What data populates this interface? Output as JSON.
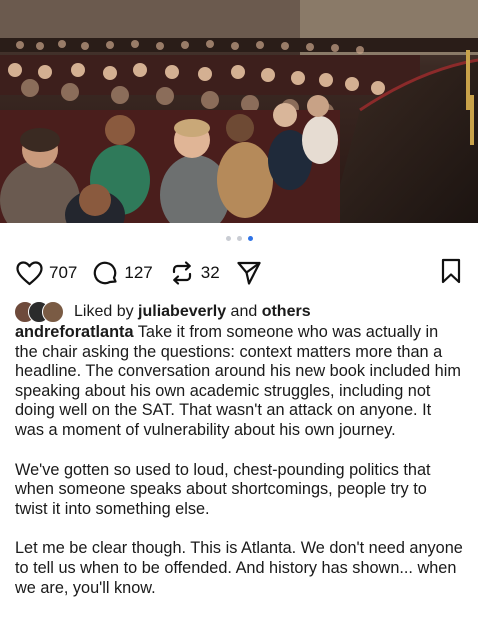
{
  "post": {
    "carousel": {
      "total": 3,
      "active_index": 2
    },
    "actions": {
      "like_count": "707",
      "comment_count": "127",
      "repost_count": "32",
      "icons": [
        "heart-icon",
        "comment-icon",
        "repost-icon",
        "share-icon",
        "bookmark-icon"
      ]
    },
    "liked_by": {
      "prefix": "Liked by",
      "user": "juliabeverly",
      "and": "and",
      "others": "others"
    },
    "caption": {
      "username": "andreforatlanta",
      "paragraph1": "Take it from someone who was actually in the chair asking the questions: context matters more than a headline. The conversation around his new book included him speaking about his own academic struggles, including not doing well on the SAT. That wasn't an attack on anyone. It was a moment of vulnerability about his own journey.",
      "paragraph2": "We've gotten so used to loud, chest-pounding politics that when someone speaks about shortcomings, people try to twist it into something else.",
      "paragraph3": "Let me be clear though. This is Atlanta. We don't need anyone to tell us when to be offended. And history has shown... when we are, you'll know."
    }
  }
}
